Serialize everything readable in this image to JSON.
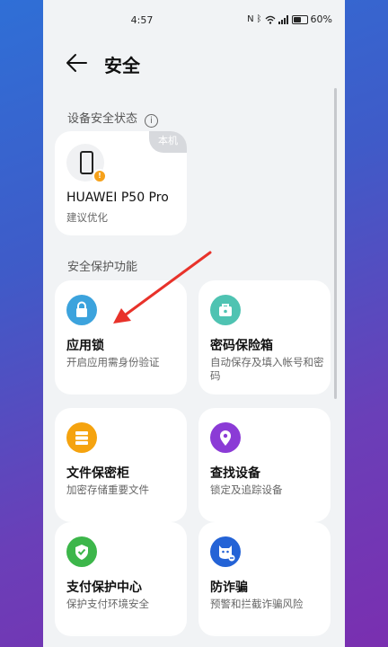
{
  "status_bar": {
    "time": "4:57",
    "battery": "60%",
    "battery_level": 0.6
  },
  "header": {
    "title": "安全"
  },
  "device_section": {
    "title": "设备安全状态",
    "card": {
      "badge": "本机",
      "name": "HUAWEI P50 Pro",
      "status": "建议优化"
    }
  },
  "features_section": {
    "title": "安全保护功能",
    "items": [
      {
        "title": "应用锁",
        "desc": "开启应用需身份验证",
        "icon": "lock-icon",
        "color": "#3ca3dd"
      },
      {
        "title": "密码保险箱",
        "desc": "自动保存及填入帐号和密码",
        "icon": "password-safe-icon",
        "color": "#4fc3b2"
      },
      {
        "title": "文件保密柜",
        "desc": "加密存储重要文件",
        "icon": "file-safe-icon",
        "color": "#f5a30f"
      },
      {
        "title": "查找设备",
        "desc": "锁定及追踪设备",
        "icon": "location-pin-icon",
        "color": "#8b3bd6"
      },
      {
        "title": "支付保护中心",
        "desc": "保护支付环境安全",
        "icon": "shield-check-icon",
        "color": "#3cb64a"
      },
      {
        "title": "防诈骗",
        "desc": "预警和拦截诈骗风险",
        "icon": "anti-fraud-icon",
        "color": "#2463d6"
      }
    ]
  },
  "annotation": {
    "arrow_color": "#e8322a"
  }
}
